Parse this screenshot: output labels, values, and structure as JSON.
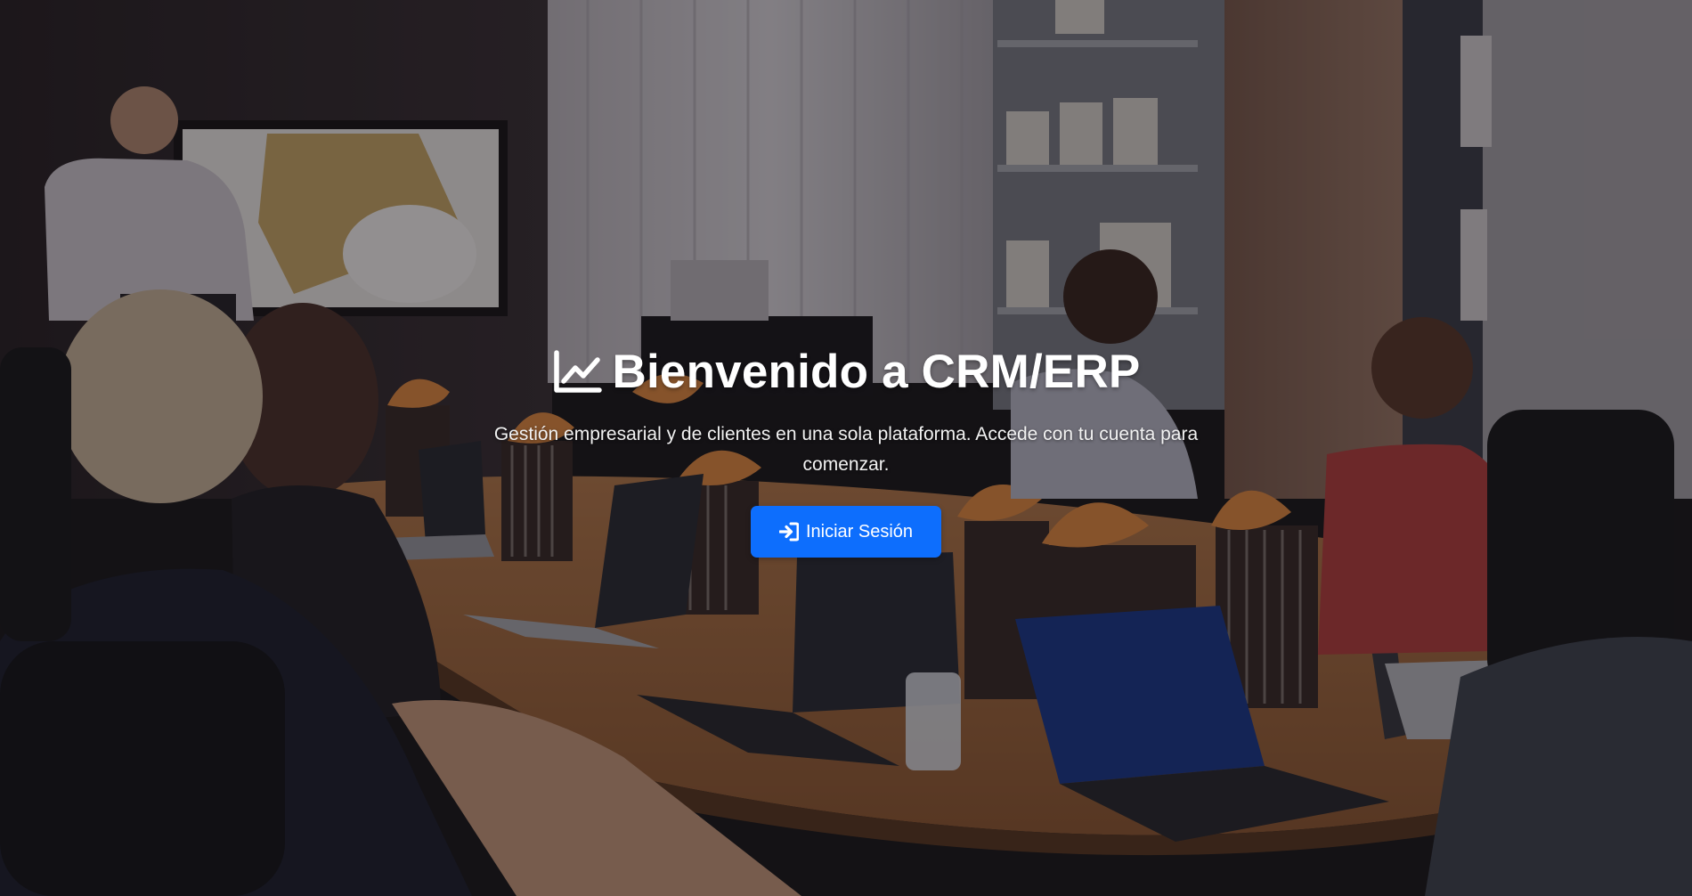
{
  "hero": {
    "title": "Bienvenido a CRM/ERP",
    "title_icon": "chart-line-icon",
    "subtitle": "Gestión empresarial y de clientes en una sola plataforma. Accede con tu cuenta para comenzar.",
    "login_button_label": "Iniciar Sesión",
    "login_button_icon": "sign-in-icon",
    "background": "meeting-room-photo"
  },
  "colors": {
    "primary_button": "#0d6efd",
    "text": "#ffffff"
  }
}
